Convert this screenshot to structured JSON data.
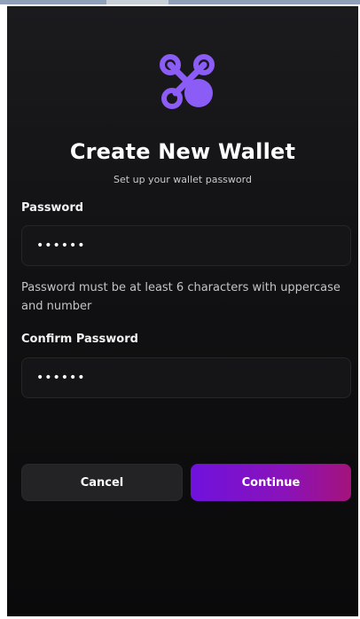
{
  "header": {
    "logo_icon": "network-node-icon",
    "title": "Create New Wallet",
    "subtitle": "Set up your wallet password"
  },
  "form": {
    "password": {
      "label": "Password",
      "value": "••••••"
    },
    "hint": "Password must be at least 6 characters with uppercase and number",
    "confirm": {
      "label": "Confirm Password",
      "value": "••••••"
    }
  },
  "actions": {
    "cancel_label": "Cancel",
    "continue_label": "Continue"
  },
  "colors": {
    "accent_purple": "#7c5cff",
    "continue_gradient_start": "#6f12dd",
    "continue_gradient_end": "#a5137b",
    "background": "#111113"
  }
}
